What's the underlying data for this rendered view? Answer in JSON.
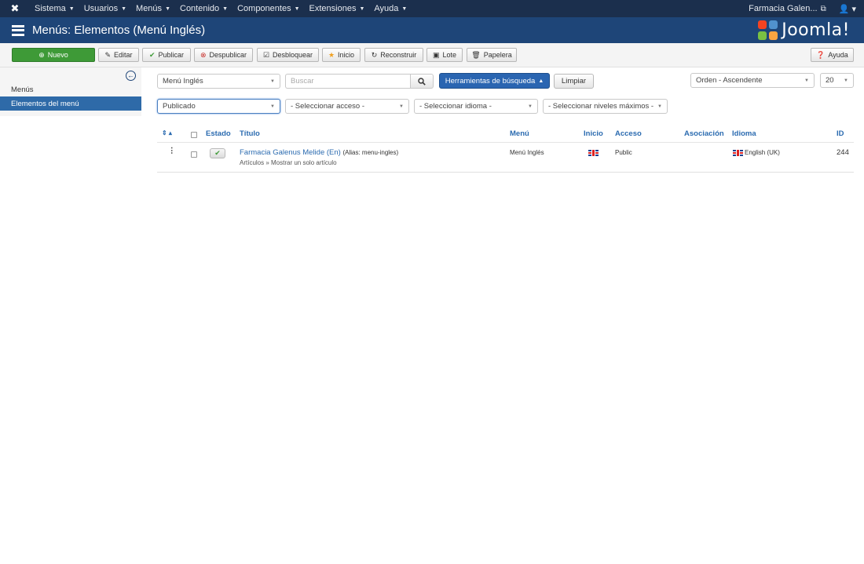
{
  "topbar": {
    "logo_icon": "joomla-icon",
    "menu": [
      {
        "label": "Sistema"
      },
      {
        "label": "Usuarios"
      },
      {
        "label": "Menús"
      },
      {
        "label": "Contenido"
      },
      {
        "label": "Componentes"
      },
      {
        "label": "Extensiones"
      },
      {
        "label": "Ayuda"
      }
    ],
    "site_name": "Farmacia Galen...",
    "site_icon": "external-link-icon",
    "user_icon": "user-icon"
  },
  "header": {
    "title": "Menús: Elementos (Menú Inglés)",
    "title_icon": "list-icon",
    "brand": "Joomla!",
    "brand_colors": [
      "#f44321",
      "#5091cd",
      "#7ac143",
      "#f9a541"
    ]
  },
  "toolbar": {
    "new": "Nuevo",
    "edit": "Editar",
    "publish": "Publicar",
    "unpublish": "Despublicar",
    "checkin": "Desbloquear",
    "home": "Inicio",
    "rebuild": "Reconstruir",
    "batch": "Lote",
    "trash": "Papelera",
    "help": "Ayuda"
  },
  "sidebar": {
    "items": [
      {
        "label": "Menús"
      },
      {
        "label": "Elementos del menú",
        "active": true
      }
    ]
  },
  "filters": {
    "menu_select": "Menú Inglés",
    "search_placeholder": "Buscar",
    "search_tools": "Herramientas de búsqueda",
    "clear": "Limpiar",
    "ordering": "Orden - Ascendente",
    "limit": "20",
    "status": "Publicado",
    "access": "- Seleccionar acceso -",
    "language": "- Seleccionar idioma -",
    "max_levels": "- Seleccionar niveles máximos -"
  },
  "table": {
    "headers": {
      "status": "Estado",
      "title": "Título",
      "menu": "Menú",
      "home": "Inicio",
      "access": "Acceso",
      "association": "Asociación",
      "language": "Idioma",
      "id": "ID"
    },
    "rows": [
      {
        "title": "Farmacia Galenus Melide (En)",
        "alias": "(Alias: menu-ingles)",
        "type": "Artículos » Mostrar un solo artículo",
        "menu": "Menú Inglés",
        "home_flag": "uk-flag-icon",
        "access": "Public",
        "language": "English (UK)",
        "id": "244"
      }
    ]
  }
}
